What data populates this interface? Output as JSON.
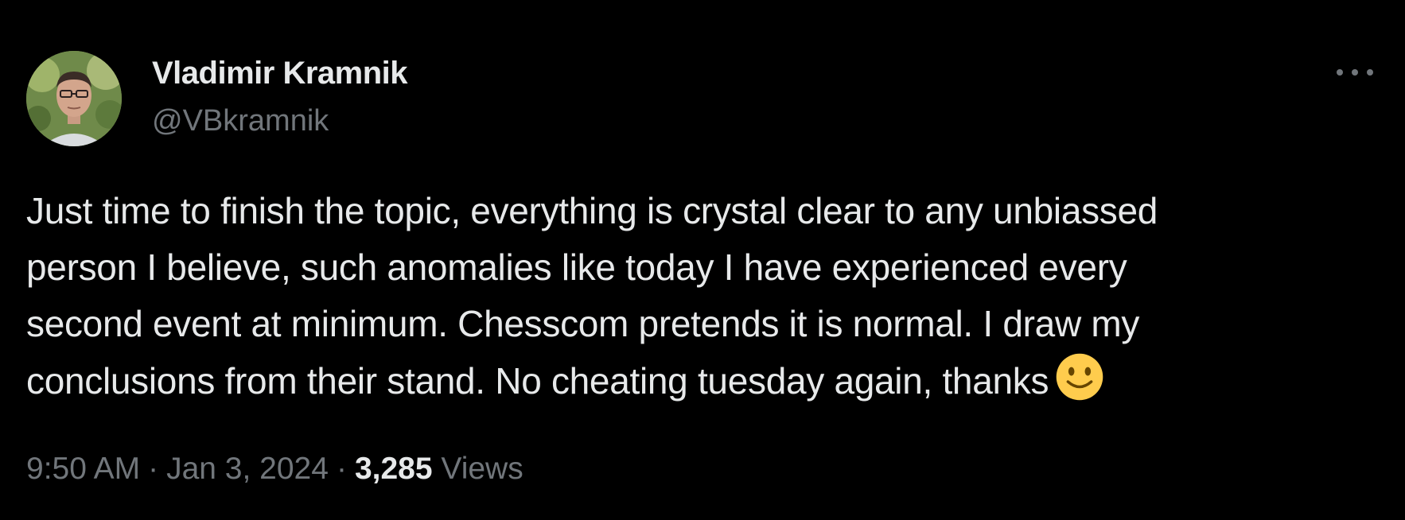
{
  "author": {
    "display_name": "Vladimir Kramnik",
    "handle": "@VBkramnik",
    "avatar_icon": "user-avatar-photo"
  },
  "more_icon": "more-horizontal-icon",
  "tweet": {
    "lines": [
      "Just time to finish the topic, everything is crystal clear to any unbiassed",
      "person I believe, such anomalies like today I have experienced every",
      "second event at minimum. Chesscom pretends it is normal. I draw my",
      "conclusions from their stand. No cheating tuesday again, thanks"
    ],
    "emoji": "slightly-smiling-face-icon"
  },
  "meta": {
    "time": "9:50 AM",
    "separator": "·",
    "date": "Jan 3, 2024",
    "views_count": "3,285",
    "views_label": "Views"
  },
  "colors": {
    "background": "#000000",
    "primary_text": "#e7e9ea",
    "secondary_text": "#71767b",
    "emoji_face": "#ffcc4d"
  }
}
